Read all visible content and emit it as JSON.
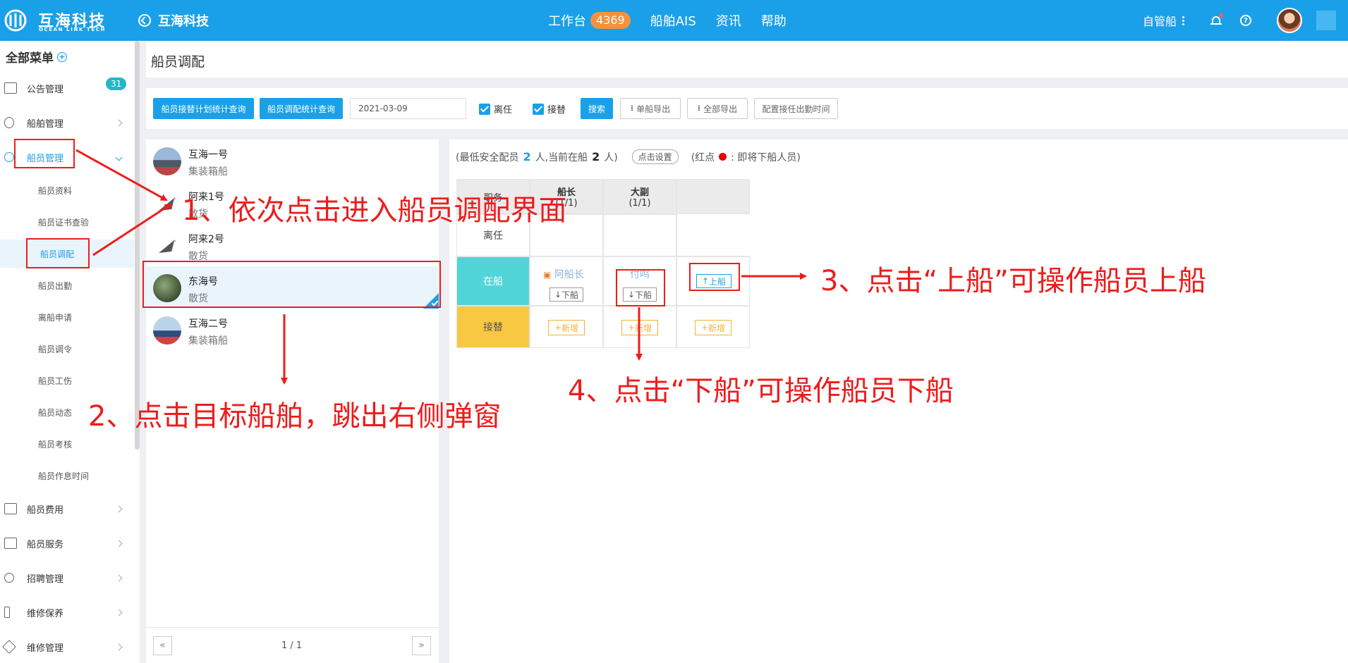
{
  "header": {
    "logo_title": "互海科技",
    "logo_subtitle": "OCEAN LINK TECH",
    "company": "互海科技",
    "nav": [
      {
        "label": "工作台",
        "badge": "4369"
      },
      {
        "label": "船舶AIS"
      },
      {
        "label": "资讯"
      },
      {
        "label": "帮助"
      }
    ],
    "ship_mode": "自管船"
  },
  "sidebar": {
    "title": "全部菜单",
    "notice_badge": "31",
    "items": [
      {
        "label": "公告管理"
      },
      {
        "label": "船舶管理"
      },
      {
        "label": "船员管理"
      },
      {
        "label": "船员费用"
      },
      {
        "label": "船员服务"
      },
      {
        "label": "招聘管理"
      },
      {
        "label": "维修保养"
      },
      {
        "label": "维修管理"
      }
    ],
    "sub_items": [
      {
        "label": "船员资料"
      },
      {
        "label": "船员证书查验"
      },
      {
        "label": "船员调配"
      },
      {
        "label": "船员出勤"
      },
      {
        "label": "离船申请"
      },
      {
        "label": "船员调令"
      },
      {
        "label": "船员工伤"
      },
      {
        "label": "船员动态"
      },
      {
        "label": "船员考核"
      },
      {
        "label": "船员作息时间"
      }
    ]
  },
  "page": {
    "title": "船员调配"
  },
  "toolbar": {
    "btn_plan_stats": "船员接替计划统计查询",
    "btn_alloc_stats": "船员调配统计查询",
    "date": "2021-03-09",
    "chk_leave": "离任",
    "chk_replace": "接替",
    "search": "搜索",
    "export_single": "单船导出",
    "export_all": "全部导出",
    "config_time": "配置接任出勤时间"
  },
  "ships": [
    {
      "name": "互海一号",
      "type": "集装箱船"
    },
    {
      "name": "阿来1号",
      "type": "散货"
    },
    {
      "name": "阿来2号",
      "type": "散货"
    },
    {
      "name": "东海号",
      "type": "散货"
    },
    {
      "name": "互海二号",
      "type": "集装箱船"
    }
  ],
  "pager": {
    "prev": "«",
    "text": "1 / 1",
    "next": "»"
  },
  "crew": {
    "info_prefix": "(最低安全配员",
    "min_count": "2",
    "info_mid": "人,当前在船",
    "current_count": "2",
    "info_suffix": "人)",
    "set_btn": "点击设置",
    "legend_prefix": "(红点",
    "legend_suffix": ":  即将下船人员)",
    "col_header": "职务",
    "captain": "船长",
    "captain_count": "(1/1)",
    "chief_mate": "大副",
    "chief_mate_count": "(1/1)",
    "row_leave": "离任",
    "row_onboard": "在船",
    "row_replace": "接替",
    "captain_person": "阿船长",
    "mate_person": "付鸣",
    "off_btn": "下船",
    "up_btn": "上船",
    "new_btn": "新增"
  },
  "annotations": {
    "step1": "1、依次点击进入船员调配界面",
    "step2": "2、点击目标船舶，跳出右侧弹窗",
    "step3": "3、点击“上船”可操作船员上船",
    "step4": "4、点击“下船”可操作船员下船"
  },
  "colors": {
    "primary": "#1aa0e8",
    "badge": "#f4923b",
    "onboard": "#52d5d8",
    "replace": "#f8c843",
    "annotation": "#ee1c1c"
  }
}
